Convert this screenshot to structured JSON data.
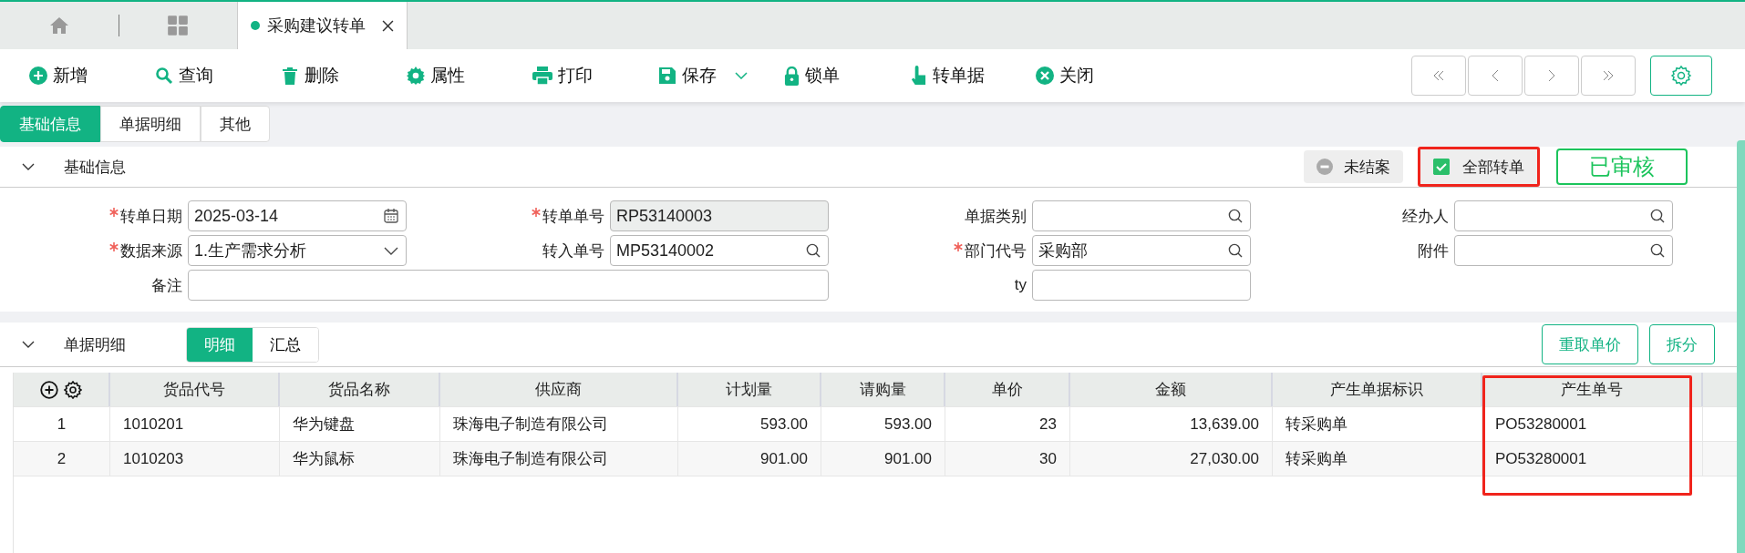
{
  "top_tabs": [
    {
      "label": "采购建议转单",
      "selected": true
    }
  ],
  "toolbar": [
    {
      "label": "新增"
    },
    {
      "label": "查询"
    },
    {
      "label": "删除"
    },
    {
      "label": "属性"
    },
    {
      "label": "打印"
    },
    {
      "label": "保存",
      "dropdown": true
    },
    {
      "label": "锁单"
    },
    {
      "label": "转单据"
    },
    {
      "label": "关闭"
    }
  ],
  "sub_tabs": [
    {
      "label": "基础信息",
      "selected": true
    },
    {
      "label": "单据明细",
      "selected": false
    },
    {
      "label": "其他",
      "selected": false
    }
  ],
  "basic_section": {
    "title": "基础信息",
    "expanded": true,
    "status": {
      "open_badge": "未结案",
      "all_converted": {
        "label": "全部转单",
        "checked": true,
        "highlighted": true
      },
      "stamp": "已审核"
    },
    "fields": [
      {
        "label": "转单日期",
        "required": true,
        "kind": "date",
        "value": "2025-03-14"
      },
      {
        "label": "转单单号",
        "required": true,
        "kind": "readonly",
        "value": "RP53140003"
      },
      {
        "label": "单据类别",
        "required": false,
        "kind": "lookup"
      },
      {
        "label": "经办人",
        "required": false,
        "kind": "lookup"
      },
      {
        "label": "数据来源",
        "required": true,
        "kind": "select",
        "value": "1.生产需求分析"
      },
      {
        "label": "转入单号",
        "required": false,
        "kind": "lookup",
        "value": "MP53140002"
      },
      {
        "label": "部门代号",
        "required": true,
        "kind": "lookup",
        "value": "采购部"
      },
      {
        "label": "附件",
        "required": false,
        "kind": "lookup"
      },
      {
        "label": "备注",
        "required": false,
        "kind": "text",
        "wide": true
      },
      {
        "label": "ty",
        "required": false,
        "kind": "text"
      }
    ]
  },
  "detail_section": {
    "title": "单据明细",
    "expanded": true,
    "view_tabs": [
      {
        "label": "明细",
        "selected": true
      },
      {
        "label": "汇总",
        "selected": false
      }
    ],
    "buttons": [
      "重取单价",
      "拆分"
    ],
    "table": {
      "columns": [
        {
          "label": "货品代号",
          "kind": "text"
        },
        {
          "label": "货品名称",
          "kind": "text"
        },
        {
          "label": "供应商",
          "kind": "text"
        },
        {
          "label": "计划量",
          "kind": "number"
        },
        {
          "label": "请购量",
          "kind": "number"
        },
        {
          "label": "单价",
          "kind": "number"
        },
        {
          "label": "金额",
          "kind": "number"
        },
        {
          "label": "产生单据标识",
          "kind": "text"
        },
        {
          "label": "产生单号",
          "kind": "text",
          "highlighted": true
        }
      ],
      "rows": [
        {
          "no": "1",
          "cells": [
            "1010201",
            "华为键盘",
            "珠海电子制造有限公司",
            "593.00",
            "593.00",
            "23",
            "13,639.00",
            "转采购单",
            "PO53280001"
          ]
        },
        {
          "no": "2",
          "cells": [
            "1010203",
            "华为鼠标",
            "珠海电子制造有限公司",
            "901.00",
            "901.00",
            "30",
            "27,030.00",
            "转采购单",
            "PO53280001"
          ]
        }
      ]
    }
  }
}
